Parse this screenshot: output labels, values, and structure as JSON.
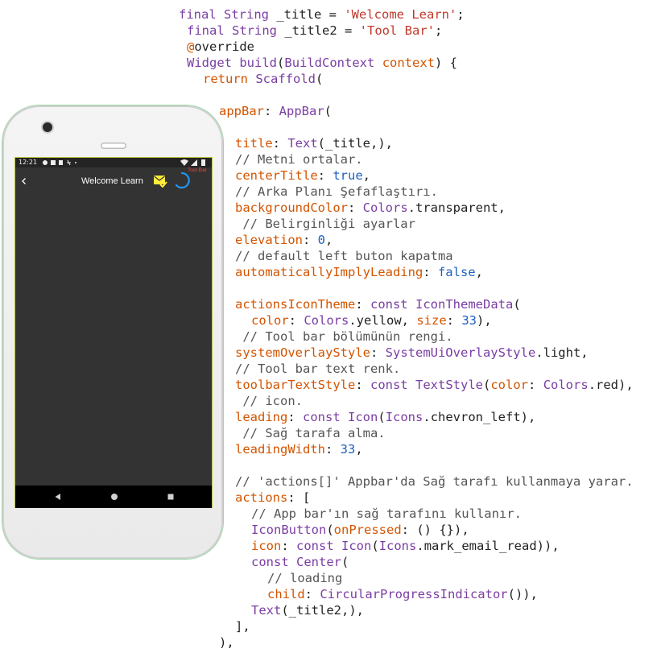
{
  "code_lines": [
    {
      "indent": 0,
      "segments": [
        [
          "kw",
          "final"
        ],
        [
          "pl",
          " "
        ],
        [
          "typ",
          "String"
        ],
        [
          "pl",
          " _title = "
        ],
        [
          "str",
          "'Welcome Learn'"
        ],
        [
          "pl",
          ";"
        ]
      ]
    },
    {
      "indent": 1,
      "segments": [
        [
          "kw",
          "final"
        ],
        [
          "pl",
          " "
        ],
        [
          "typ",
          "String"
        ],
        [
          "pl",
          " _title2 = "
        ],
        [
          "str",
          "'Tool Bar'"
        ],
        [
          "pl",
          ";"
        ]
      ]
    },
    {
      "indent": 1,
      "segments": [
        [
          "prop",
          "@"
        ],
        [
          "pl",
          "override"
        ]
      ]
    },
    {
      "indent": 1,
      "segments": [
        [
          "typ",
          "Widget"
        ],
        [
          "pl",
          " "
        ],
        [
          "kw",
          "build"
        ],
        [
          "pl",
          "("
        ],
        [
          "typ",
          "BuildContext"
        ],
        [
          "pl",
          " "
        ],
        [
          "prop",
          "context"
        ],
        [
          "pl",
          ") {"
        ]
      ]
    },
    {
      "indent": 2,
      "segments": [
        [
          "prop",
          "return"
        ],
        [
          "pl",
          " "
        ],
        [
          "typ",
          "Scaffold"
        ],
        [
          "pl",
          "("
        ]
      ]
    },
    {
      "indent": 3,
      "segments": [
        [
          "prop",
          "appBar"
        ],
        [
          "pl",
          ": "
        ],
        [
          "typ",
          "AppBar"
        ],
        [
          "pl",
          "("
        ]
      ]
    },
    {
      "indent": 4,
      "segments": [
        [
          "prop",
          "title"
        ],
        [
          "pl",
          ": "
        ],
        [
          "typ",
          "Text"
        ],
        [
          "pl",
          "(_title,),"
        ]
      ]
    },
    {
      "indent": 4,
      "segments": [
        [
          "cmt",
          "// Metni ortalar."
        ]
      ]
    },
    {
      "indent": 4,
      "segments": [
        [
          "prop",
          "centerTitle"
        ],
        [
          "pl",
          ": "
        ],
        [
          "val",
          "true"
        ],
        [
          "pl",
          ","
        ]
      ]
    },
    {
      "indent": 4,
      "segments": [
        [
          "cmt",
          "// Arka Planı Şefaflaştırı."
        ]
      ]
    },
    {
      "indent": 4,
      "segments": [
        [
          "prop",
          "backgroundColor"
        ],
        [
          "pl",
          ": "
        ],
        [
          "typ",
          "Colors"
        ],
        [
          "pl",
          ".transparent,"
        ]
      ]
    },
    {
      "indent": 4,
      "segments": [
        [
          "cmt",
          " // Belirginliği ayarlar"
        ]
      ]
    },
    {
      "indent": 4,
      "segments": [
        [
          "prop",
          "elevation"
        ],
        [
          "pl",
          ": "
        ],
        [
          "val",
          "0"
        ],
        [
          "pl",
          ","
        ]
      ]
    },
    {
      "indent": 4,
      "segments": [
        [
          "cmt",
          "// default left buton kapatma"
        ]
      ]
    },
    {
      "indent": 4,
      "segments": [
        [
          "prop",
          "automaticallyImplyLeading"
        ],
        [
          "pl",
          ": "
        ],
        [
          "val",
          "false"
        ],
        [
          "pl",
          ","
        ]
      ]
    },
    {
      "indent": 4,
      "segments": []
    },
    {
      "indent": 4,
      "segments": [
        [
          "prop",
          "actionsIconTheme"
        ],
        [
          "pl",
          ": "
        ],
        [
          "kw",
          "const"
        ],
        [
          "pl",
          " "
        ],
        [
          "typ",
          "IconThemeData"
        ],
        [
          "pl",
          "("
        ]
      ]
    },
    {
      "indent": 5,
      "segments": [
        [
          "prop",
          "color"
        ],
        [
          "pl",
          ": "
        ],
        [
          "typ",
          "Colors"
        ],
        [
          "pl",
          ".yellow, "
        ],
        [
          "prop",
          "size"
        ],
        [
          "pl",
          ": "
        ],
        [
          "val",
          "33"
        ],
        [
          "pl",
          "),"
        ]
      ]
    },
    {
      "indent": 4,
      "segments": [
        [
          "cmt",
          " // Tool bar bölümünün rengi."
        ]
      ]
    },
    {
      "indent": 4,
      "segments": [
        [
          "prop",
          "systemOverlayStyle"
        ],
        [
          "pl",
          ": "
        ],
        [
          "typ",
          "SystemUiOverlayStyle"
        ],
        [
          "pl",
          ".light,"
        ]
      ]
    },
    {
      "indent": 4,
      "segments": [
        [
          "cmt",
          "// Tool bar text renk."
        ]
      ]
    },
    {
      "indent": 4,
      "segments": [
        [
          "prop",
          "toolbarTextStyle"
        ],
        [
          "pl",
          ": "
        ],
        [
          "kw",
          "const"
        ],
        [
          "pl",
          " "
        ],
        [
          "typ",
          "TextStyle"
        ],
        [
          "pl",
          "("
        ],
        [
          "prop",
          "color"
        ],
        [
          "pl",
          ": "
        ],
        [
          "typ",
          "Colors"
        ],
        [
          "pl",
          ".red),"
        ]
      ]
    },
    {
      "indent": 4,
      "segments": [
        [
          "cmt",
          " // icon."
        ]
      ]
    },
    {
      "indent": 4,
      "segments": [
        [
          "prop",
          "leading"
        ],
        [
          "pl",
          ": "
        ],
        [
          "kw",
          "const"
        ],
        [
          "pl",
          " "
        ],
        [
          "typ",
          "Icon"
        ],
        [
          "pl",
          "("
        ],
        [
          "typ",
          "Icons"
        ],
        [
          "pl",
          ".chevron_left),"
        ]
      ]
    },
    {
      "indent": 4,
      "segments": [
        [
          "cmt",
          " // Sağ tarafa alma."
        ]
      ]
    },
    {
      "indent": 4,
      "segments": [
        [
          "prop",
          "leadingWidth"
        ],
        [
          "pl",
          ": "
        ],
        [
          "val",
          "33"
        ],
        [
          "pl",
          ","
        ]
      ]
    },
    {
      "indent": 4,
      "segments": []
    },
    {
      "indent": 4,
      "segments": [
        [
          "cmt",
          "// 'actions[]' Appbar'da Sağ tarafı kullanmaya yarar."
        ]
      ]
    },
    {
      "indent": 4,
      "segments": [
        [
          "prop",
          "actions"
        ],
        [
          "pl",
          ": ["
        ]
      ]
    },
    {
      "indent": 5,
      "segments": [
        [
          "cmt",
          "// App bar'ın sağ tarafını kullanır."
        ]
      ]
    },
    {
      "indent": 5,
      "segments": [
        [
          "typ",
          "IconButton"
        ],
        [
          "pl",
          "("
        ],
        [
          "prop",
          "onPressed"
        ],
        [
          "pl",
          ": () {}),"
        ]
      ]
    },
    {
      "indent": 5,
      "segments": [
        [
          "prop",
          "icon"
        ],
        [
          "pl",
          ": "
        ],
        [
          "kw",
          "const"
        ],
        [
          "pl",
          " "
        ],
        [
          "typ",
          "Icon"
        ],
        [
          "pl",
          "("
        ],
        [
          "typ",
          "Icons"
        ],
        [
          "pl",
          ".mark_email_read)),"
        ]
      ]
    },
    {
      "indent": 5,
      "segments": [
        [
          "kw",
          "const"
        ],
        [
          "pl",
          " "
        ],
        [
          "typ",
          "Center"
        ],
        [
          "pl",
          "("
        ]
      ]
    },
    {
      "indent": 6,
      "segments": [
        [
          "cmt",
          "// loading"
        ]
      ]
    },
    {
      "indent": 6,
      "segments": [
        [
          "prop",
          "child"
        ],
        [
          "pl",
          ": "
        ],
        [
          "typ",
          "CircularProgressIndicator"
        ],
        [
          "pl",
          "()),"
        ]
      ]
    },
    {
      "indent": 5,
      "segments": [
        [
          "typ",
          "Text"
        ],
        [
          "pl",
          "(_title2,),"
        ]
      ]
    },
    {
      "indent": 4,
      "segments": [
        [
          "pl",
          "],"
        ]
      ]
    },
    {
      "indent": 3,
      "segments": [
        [
          "pl",
          "),"
        ]
      ]
    }
  ],
  "colors": {
    "keyword": "#7a3da3",
    "type": "#7a3da3",
    "string": "#c0392b",
    "property": "#d35400",
    "value": "#1f5fbf",
    "comment": "#555555",
    "plain": "#222222"
  },
  "phone": {
    "status_time": "12:21",
    "appbar_title": "Welcome Learn",
    "toolbar_text": "Tool Bar",
    "leading_icon": "chevron-left-icon",
    "action_icon": "mark-email-read-icon",
    "loading_icon": "circular-progress-icon",
    "nav_icons": [
      "back-triangle-icon",
      "home-circle-icon",
      "recents-square-icon"
    ],
    "colors": {
      "screen_bg": "#333333",
      "icon_yellow": "#ffeb3b",
      "progress_blue": "#2196f3",
      "toolbar_red": "#f44336"
    }
  }
}
